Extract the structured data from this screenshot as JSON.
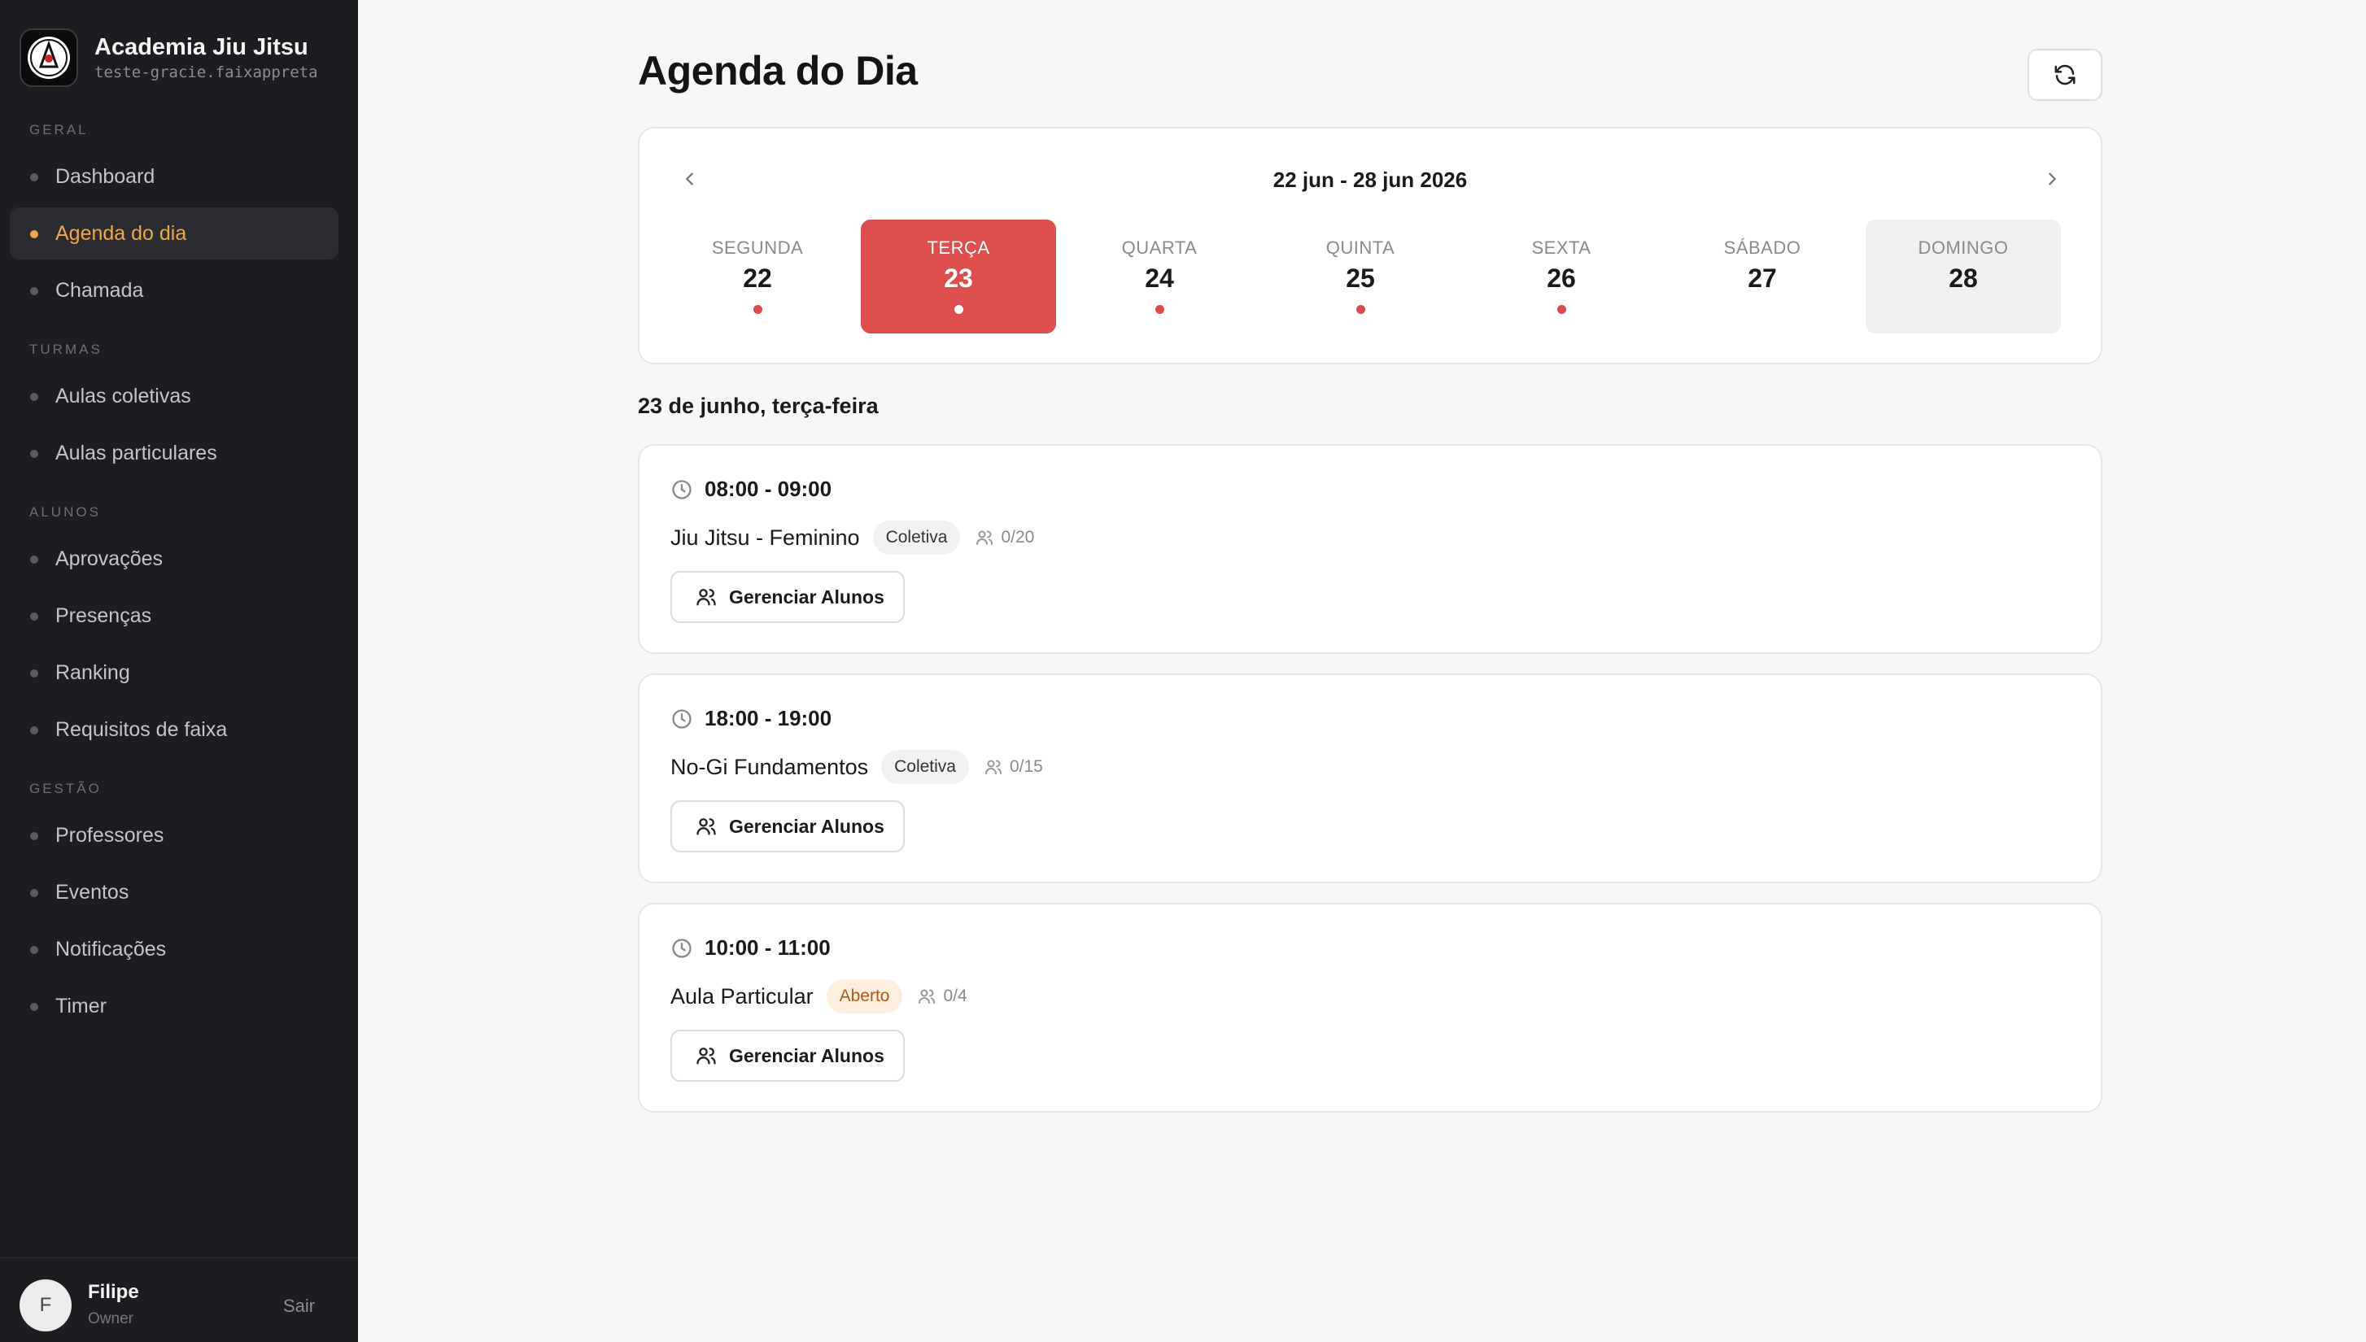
{
  "sidebar": {
    "brand": {
      "title": "Academia Jiu Jitsu",
      "subtitle": "teste-gracie.faixappreta"
    },
    "sections": [
      {
        "label": "GERAL",
        "items": [
          "Dashboard",
          "Agenda do dia",
          "Chamada"
        ]
      },
      {
        "label": "TURMAS",
        "items": [
          "Aulas coletivas",
          "Aulas particulares"
        ]
      },
      {
        "label": "ALUNOS",
        "items": [
          "Aprovações",
          "Presenças",
          "Ranking",
          "Requisitos de faixa"
        ]
      },
      {
        "label": "GESTÃO",
        "items": [
          "Professores",
          "Eventos",
          "Notificações",
          "Timer"
        ]
      }
    ],
    "active_item": "Agenda do dia",
    "accent_color": "#f2a64b",
    "user": {
      "initial": "F",
      "name": "Filipe",
      "role": "Owner",
      "logout_label": "Sair"
    }
  },
  "main": {
    "title": "Agenda do Dia",
    "refresh_icon": "refresh-icon",
    "calendar": {
      "range": "22 jun - 28 jun 2026",
      "days": [
        {
          "name": "SEGUNDA",
          "num": "22",
          "has_classes": true
        },
        {
          "name": "TERÇA",
          "num": "23",
          "has_classes": true,
          "selected": true
        },
        {
          "name": "QUARTA",
          "num": "24",
          "has_classes": true
        },
        {
          "name": "QUINTA",
          "num": "25",
          "has_classes": true
        },
        {
          "name": "SEXTA",
          "num": "26",
          "has_classes": true
        },
        {
          "name": "SÁBADO",
          "num": "27",
          "has_classes": false
        },
        {
          "name": "DOMINGO",
          "num": "28",
          "has_classes": false,
          "today": true
        }
      ],
      "selected_color": "#dd4e4e"
    },
    "date_heading": "23 de junho, terça-feira",
    "classes": [
      {
        "time": "08:00 - 09:00",
        "name": "Jiu Jitsu - Feminino",
        "badge": "Coletiva",
        "badge_type": "coletiva",
        "capacity": "0/20",
        "button": "Gerenciar Alunos"
      },
      {
        "time": "18:00 - 19:00",
        "name": "No-Gi Fundamentos",
        "badge": "Coletiva",
        "badge_type": "coletiva",
        "capacity": "0/15",
        "button": "Gerenciar Alunos"
      },
      {
        "time": "10:00 - 11:00",
        "name": "Aula Particular",
        "badge": "Aberto",
        "badge_type": "aberto",
        "capacity": "0/4",
        "button": "Gerenciar Alunos"
      }
    ]
  }
}
